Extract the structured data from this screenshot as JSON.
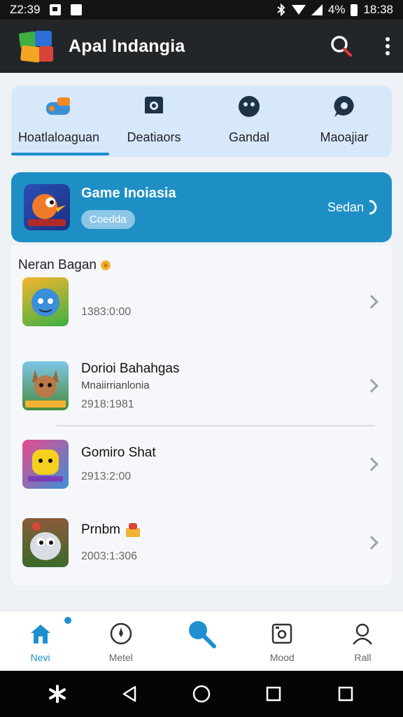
{
  "status_bar": {
    "time_left": "Z2:39",
    "battery_percent": "4%",
    "time_right": "18:38"
  },
  "app_bar": {
    "title": "Apal Indangia",
    "icons": [
      "search-icon",
      "more-vert-icon"
    ]
  },
  "tabs": [
    {
      "label": "Hoatlaloaguan",
      "icon": "controller-icon",
      "active": true
    },
    {
      "label": "Deatiaors",
      "icon": "camera-icon",
      "active": false
    },
    {
      "label": "Gandal",
      "icon": "face-icon",
      "active": false
    },
    {
      "label": "Maoajiar",
      "icon": "chat-icon",
      "active": false
    }
  ],
  "banner": {
    "title": "Game Inoiasia",
    "badge": "Coedda",
    "action": "Sedan"
  },
  "list": {
    "header": "Neran Bagan",
    "items": [
      {
        "title": "",
        "subtitle": "",
        "meta": "1383:0:00"
      },
      {
        "title": "Dorioi Bahahgas",
        "subtitle": "Mnaiirrianlonia",
        "meta": "2918:1981"
      },
      {
        "title": "Gomiro Shat",
        "subtitle": "",
        "meta": "2913:2:00"
      },
      {
        "title": "Prnbm",
        "subtitle": "",
        "meta": "2003:1:306"
      }
    ]
  },
  "bottom_nav": [
    {
      "label": "Nevi",
      "icon": "home-icon",
      "active": true
    },
    {
      "label": "Metel",
      "icon": "compass-icon",
      "active": false
    },
    {
      "label": "",
      "icon": "search-icon",
      "active": false
    },
    {
      "label": "Mood",
      "icon": "camera-frame-icon",
      "active": false
    },
    {
      "label": "Rall",
      "icon": "user-icon",
      "active": false
    }
  ],
  "colors": {
    "accent": "#1e8fd0",
    "banner": "#1e8fc4",
    "app_bar": "#232629",
    "tab_card": "#d8e8fb"
  }
}
